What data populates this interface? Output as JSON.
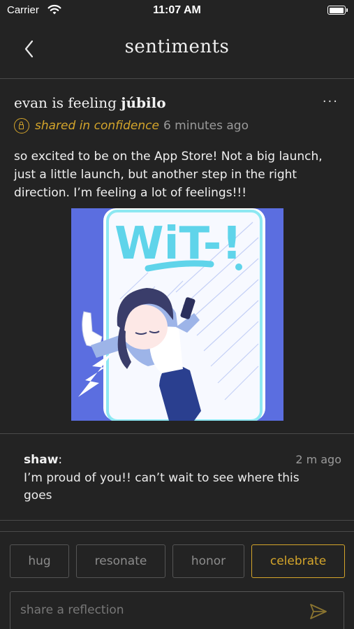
{
  "status_bar": {
    "carrier": "Carrier",
    "time": "11:07 AM",
    "battery_level": 1.0
  },
  "nav": {
    "title": "sentiments",
    "back_icon": "chevron-left-icon"
  },
  "post": {
    "author": "evan",
    "feeling_prefix": "is feeling",
    "feeling": "júbilo",
    "privacy_icon": "lock-icon",
    "privacy_label": "shared in confidence",
    "timestamp": "6 minutes ago",
    "more_icon": "more-icon",
    "more_label": "···",
    "body": "so excited to be on the App Store! Not a big launch, just a little launch, but another step in the right direction. I’m feeling a lot of feelings!!!",
    "image_text": "WiT-!"
  },
  "comment": {
    "author": "shaw",
    "separator": ":",
    "time": "2 m ago",
    "text": "I’m proud of you!! can’t wait to see where this goes"
  },
  "reactions": [
    {
      "label": "hug",
      "active": false
    },
    {
      "label": "resonate",
      "active": false
    },
    {
      "label": "honor",
      "active": false
    },
    {
      "label": "celebrate",
      "active": true
    }
  ],
  "reflection": {
    "placeholder": "share a reflection",
    "send_icon": "send-icon"
  },
  "colors": {
    "background": "#232323",
    "accent": "#d4a52b",
    "divider": "#4a4a4a",
    "muted_text": "#9a9a9a",
    "image_background": "#5b6ee0"
  }
}
